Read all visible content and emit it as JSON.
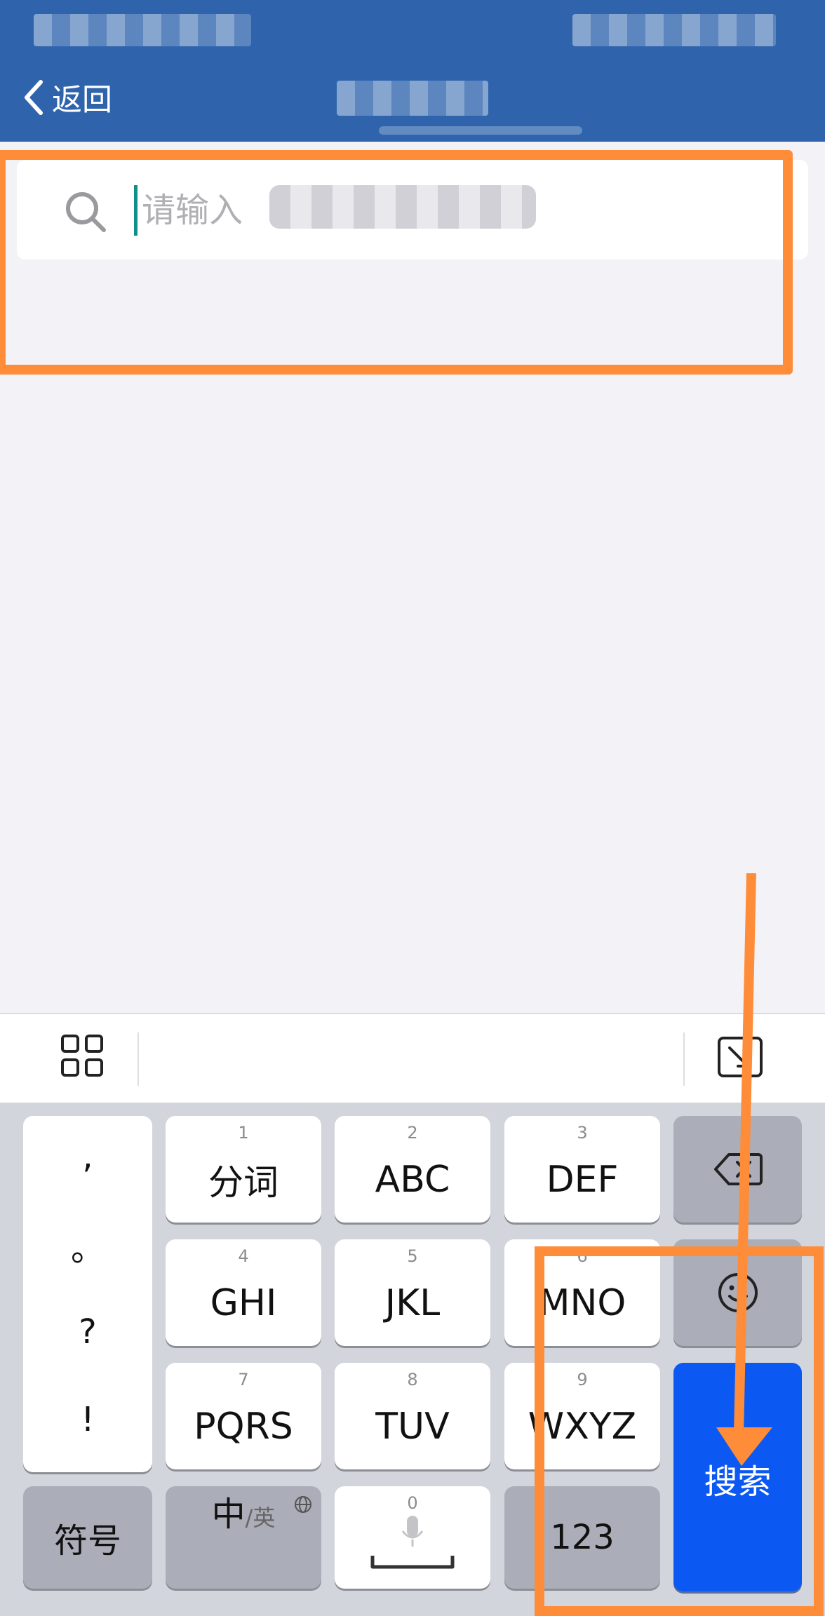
{
  "header": {
    "back_label": "返回",
    "background_color": "#2f64ad"
  },
  "search": {
    "placeholder": "请输入",
    "icon": "search-icon",
    "caret_color": "#0f8f88"
  },
  "annotation": {
    "color": "#ff8c38",
    "arrow_icon": "arrow-down-icon"
  },
  "toolbar": {
    "left_icon": "menu-grid-icon",
    "right_icon": "keyboard-collapse-icon"
  },
  "keyboard": {
    "punctuation": [
      ",",
      "。",
      "?",
      "!"
    ],
    "keys": [
      {
        "num": "1",
        "label": "分词"
      },
      {
        "num": "2",
        "label": "ABC"
      },
      {
        "num": "3",
        "label": "DEF"
      },
      {
        "num": "4",
        "label": "GHI"
      },
      {
        "num": "5",
        "label": "JKL"
      },
      {
        "num": "6",
        "label": "MNO"
      },
      {
        "num": "7",
        "label": "PQRS"
      },
      {
        "num": "8",
        "label": "TUV"
      },
      {
        "num": "9",
        "label": "WXYZ"
      }
    ],
    "symbols_label": "符号",
    "chinese_label": "中",
    "english_label": "/英",
    "space_num": "0",
    "numbers_label": "123",
    "search_label": "搜索",
    "search_key_color": "#0b59f2"
  }
}
